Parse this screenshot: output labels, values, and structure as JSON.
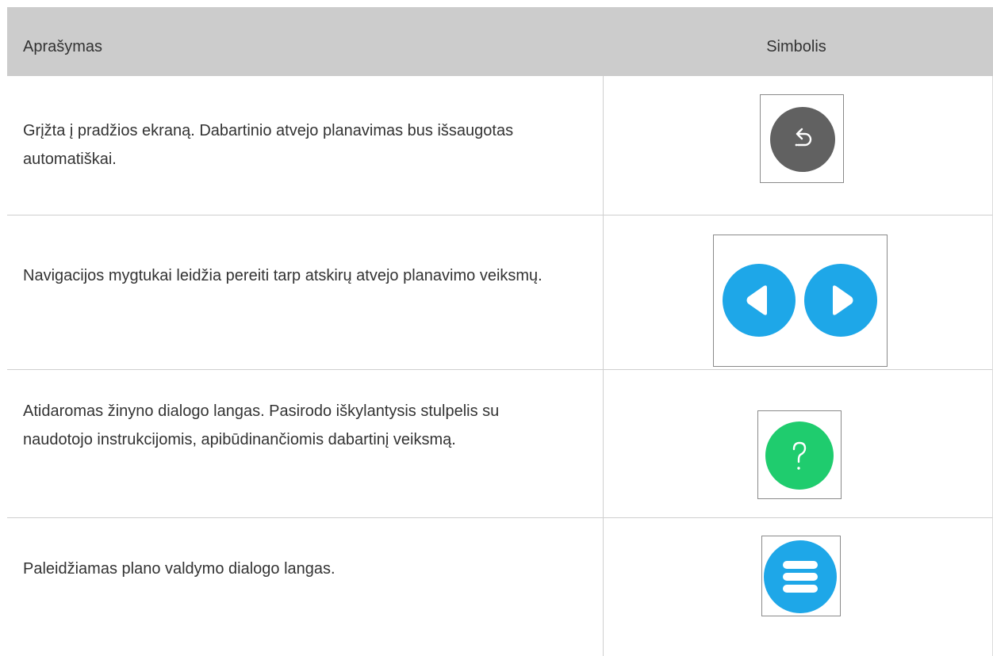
{
  "header": {
    "description_label": "Aprašymas",
    "symbol_label": "Simbolis"
  },
  "rows": [
    {
      "description": "Grįžta į pradžios ekraną. Dabartinio atvejo planavimas bus išsaugotas automatiškai.",
      "icon": "home-return-icon",
      "color": "#616161"
    },
    {
      "description": "Navigacijos mygtukai leidžia pereiti tarp atskirų atvejo planavimo veiksmų.",
      "icons": [
        "previous-arrow-icon",
        "next-arrow-icon"
      ],
      "color": "#1ea7e8"
    },
    {
      "description": "Atidaromas žinyno dialogo langas. Pasirodo iškylantysis stulpelis su naudotojo instrukcijomis, apibūdinančiomis dabartinį veiksmą.",
      "icon": "help-icon",
      "icon_text": "?",
      "color": "#1fcc6e"
    },
    {
      "description": "Paleidžiamas plano valdymo dialogo langas.",
      "icon": "menu-icon",
      "color": "#1ea7e8"
    }
  ]
}
